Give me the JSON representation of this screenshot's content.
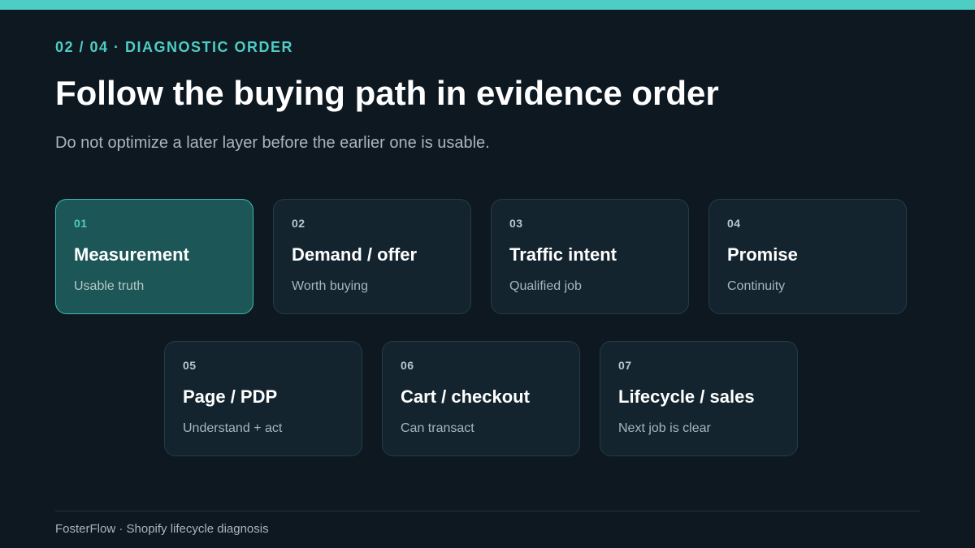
{
  "header": {
    "eyebrow": "02 / 04 · DIAGNOSTIC ORDER",
    "title": "Follow the buying path in evidence order",
    "subtitle": "Do not optimize a later layer before the earlier one is usable."
  },
  "steps": [
    {
      "num": "01",
      "title": "Measurement",
      "desc": "Usable truth",
      "active": true
    },
    {
      "num": "02",
      "title": "Demand / offer",
      "desc": "Worth buying",
      "active": false
    },
    {
      "num": "03",
      "title": "Traffic intent",
      "desc": "Qualified job",
      "active": false
    },
    {
      "num": "04",
      "title": "Promise",
      "desc": "Continuity",
      "active": false
    },
    {
      "num": "05",
      "title": "Page / PDP",
      "desc": "Understand + act",
      "active": false
    },
    {
      "num": "06",
      "title": "Cart / checkout",
      "desc": "Can transact",
      "active": false
    },
    {
      "num": "07",
      "title": "Lifecycle / sales",
      "desc": "Next job is clear",
      "active": false
    }
  ],
  "footer": {
    "text": "FosterFlow · Shopify lifecycle diagnosis"
  },
  "colors": {
    "accent": "#4ecdc4",
    "background": "#0e1821",
    "card": "#13242f",
    "active_card": "#1d5656"
  }
}
